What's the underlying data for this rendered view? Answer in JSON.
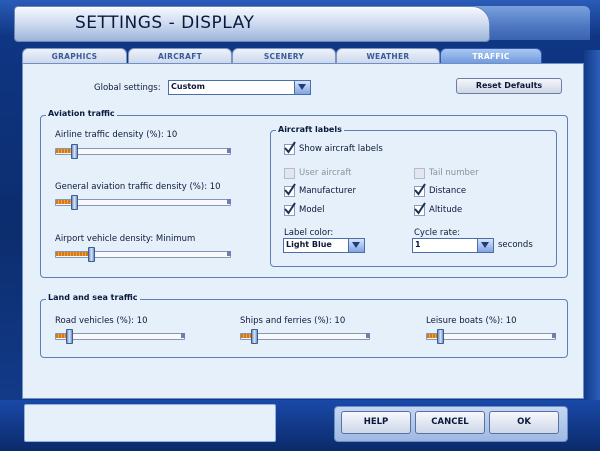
{
  "window": {
    "title": "SETTINGS - DISPLAY"
  },
  "tabs": [
    {
      "label": "GRAPHICS",
      "active": false
    },
    {
      "label": "AIRCRAFT",
      "active": false
    },
    {
      "label": "SCENERY",
      "active": false
    },
    {
      "label": "WEATHER",
      "active": false
    },
    {
      "label": "TRAFFIC",
      "active": true
    }
  ],
  "global": {
    "label": "Global settings:",
    "value": "Custom",
    "reset_label": "Reset Defaults"
  },
  "aviation": {
    "title": "Aviation traffic",
    "airline": {
      "label": "Airline traffic density (%): 10",
      "level": 0.1
    },
    "general": {
      "label": "General aviation traffic density (%): 10",
      "level": 0.1
    },
    "airport": {
      "label": "Airport vehicle density: Minimum",
      "level": 0.2
    }
  },
  "labels_group": {
    "title": "Aircraft labels",
    "show": {
      "label": "Show aircraft labels",
      "checked": true
    },
    "user_aircraft": {
      "label": "User aircraft",
      "checked": false
    },
    "tail_number": {
      "label": "Tail number",
      "checked": false
    },
    "manufacturer": {
      "label": "Manufacturer",
      "checked": true
    },
    "distance": {
      "label": "Distance",
      "checked": true
    },
    "model": {
      "label": "Model",
      "checked": true
    },
    "altitude": {
      "label": "Altitude",
      "checked": true
    },
    "label_color": {
      "label": "Label color:",
      "value": "Light Blue"
    },
    "cycle_rate": {
      "label": "Cycle rate:",
      "value": "1",
      "unit": "seconds"
    }
  },
  "land_sea": {
    "title": "Land and sea traffic",
    "road": {
      "label": "Road vehicles (%): 10",
      "level": 0.1
    },
    "ships": {
      "label": "Ships and ferries (%): 10",
      "level": 0.1
    },
    "leisure": {
      "label": "Leisure boats (%): 10",
      "level": 0.1
    }
  },
  "footer": {
    "help": "HELP",
    "cancel": "CANCEL",
    "ok": "OK"
  },
  "colors": {
    "accent": "#6f98db",
    "fill": "#d27a1a",
    "panel": "#e6f0fb",
    "frame": "#0d2f73"
  }
}
